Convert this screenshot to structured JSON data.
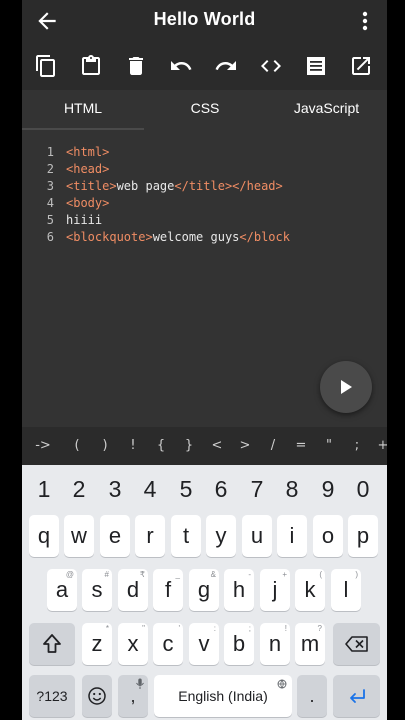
{
  "app": {
    "title": "Hello World"
  },
  "tabs": [
    {
      "label": "HTML"
    },
    {
      "label": "CSS"
    },
    {
      "label": "JavaScript"
    }
  ],
  "editor": {
    "lines": [
      {
        "number": "1",
        "code": "<html>"
      },
      {
        "number": "2",
        "code": "<head>"
      },
      {
        "number": "3",
        "tag1": "<title>",
        "text": "web page",
        "tag2": "</title></head>"
      },
      {
        "number": "4",
        "code": "<body>"
      },
      {
        "number": "5",
        "text": "hiiii"
      },
      {
        "number": "6",
        "tag1": "<blockquote>",
        "text": "welcome guys",
        "tag2": "</block"
      }
    ]
  },
  "symbols": [
    "->",
    "(",
    ")",
    "!",
    "{",
    "}",
    "<",
    ">",
    "/",
    "=",
    "\"",
    ";",
    "+"
  ],
  "keyboard": {
    "numbers": [
      "1",
      "2",
      "3",
      "4",
      "5",
      "6",
      "7",
      "8",
      "9",
      "0"
    ],
    "row1": [
      "q",
      "w",
      "e",
      "r",
      "t",
      "y",
      "u",
      "i",
      "o",
      "p"
    ],
    "row2": [
      "a",
      "s",
      "d",
      "f",
      "g",
      "h",
      "j",
      "k",
      "l"
    ],
    "row2_hints": [
      "@",
      "#",
      "₹",
      "_",
      "&",
      "-",
      "+",
      "(",
      ")"
    ],
    "row3": [
      "z",
      "x",
      "c",
      "v",
      "b",
      "n",
      "m"
    ],
    "row3_hints": [
      "*",
      "\"",
      "'",
      ":",
      ";",
      "!",
      "?"
    ],
    "symbols_key": "?123",
    "comma": ",",
    "period": ".",
    "space_label": "English (India)"
  },
  "colors": {
    "tag": "#f08d64",
    "text": "#e8e8e8",
    "background": "#333333",
    "enter_icon": "#1a73e8"
  }
}
